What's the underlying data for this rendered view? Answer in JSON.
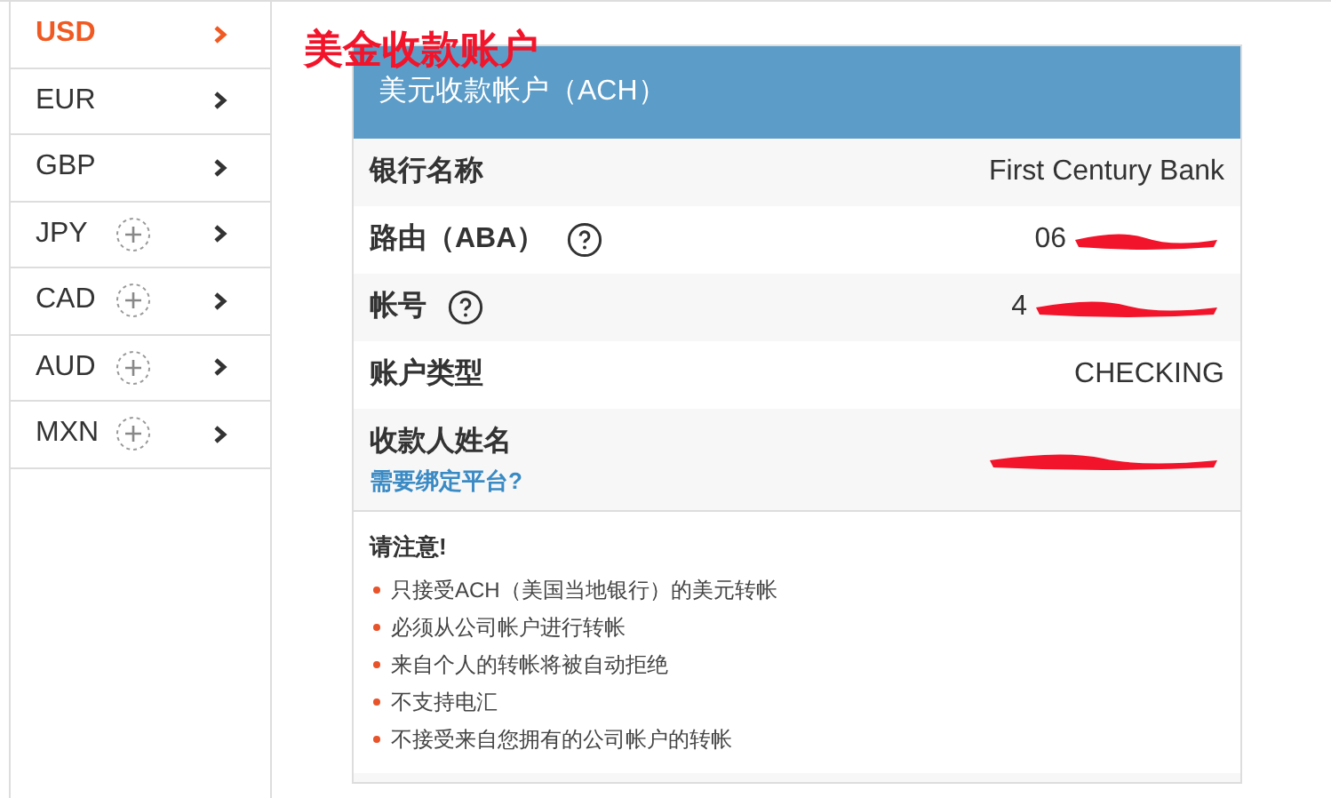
{
  "currencies": [
    {
      "label": "USD",
      "selected": true,
      "addable": false
    },
    {
      "label": "EUR",
      "selected": false,
      "addable": false
    },
    {
      "label": "GBP",
      "selected": false,
      "addable": false
    },
    {
      "label": "JPY",
      "selected": false,
      "addable": true
    },
    {
      "label": "CAD",
      "selected": false,
      "addable": true
    },
    {
      "label": "AUD",
      "selected": false,
      "addable": true
    },
    {
      "label": "MXN",
      "selected": false,
      "addable": true
    }
  ],
  "annotation": "美金收款账户",
  "card": {
    "title": "美元收款帐户（ACH）",
    "rows": [
      {
        "label": "银行名称",
        "help": false,
        "value": "First Century Bank",
        "redacted": false
      },
      {
        "label": "路由（ABA）",
        "help": true,
        "value": "06",
        "redacted": true
      },
      {
        "label": "帐号",
        "help": true,
        "value": "4",
        "redacted": true
      },
      {
        "label": "账户类型",
        "help": false,
        "value": "CHECKING",
        "redacted": false
      },
      {
        "label": "收款人姓名",
        "help": false,
        "link": "需要绑定平台?",
        "redacted": true
      }
    ]
  },
  "notes": {
    "title": "请注意!",
    "items": [
      "只接受ACH（美国当地银行）的美元转帐",
      "必须从公司帐户进行转帐",
      "来自个人的转帐将被自动拒绝",
      "不支持电汇",
      "不接受来自您拥有的公司帐户的转帐"
    ]
  }
}
